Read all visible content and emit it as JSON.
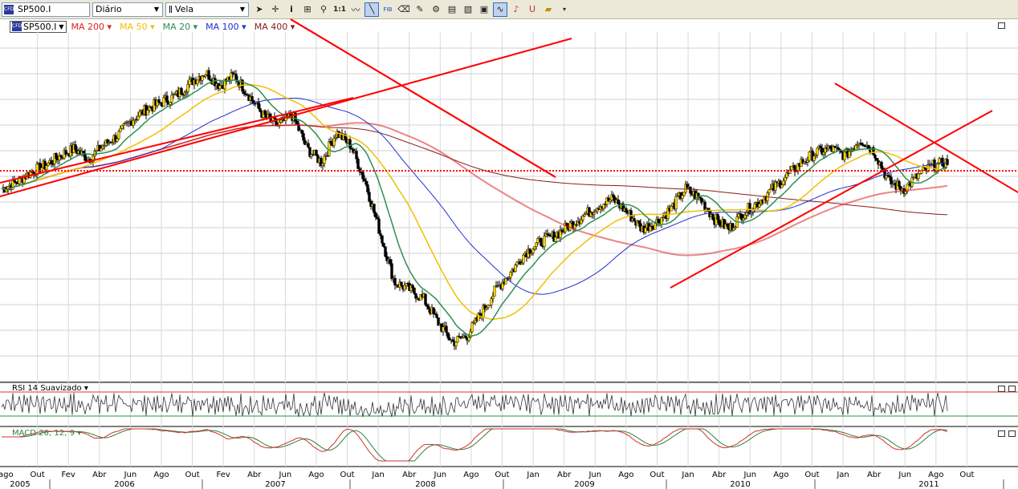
{
  "toolbar": {
    "symbol": "SP500.I",
    "period": "Diário",
    "chart_style": "Vela",
    "tools": [
      "cursor-icon",
      "crosshair-icon",
      "info-icon",
      "grid-icon",
      "zoom-icon",
      "ratio-icon",
      "line-style-icon",
      "trendline-icon",
      "fibonacci-icon",
      "eraser-icon",
      "draw-icon",
      "objects-icon",
      "indicator-icon",
      "compare-icon",
      "template-icon",
      "wave-icon",
      "sound-icon",
      "magnet-icon",
      "folder-icon"
    ],
    "fib_label": "FIB",
    "ratio_label": "1:1"
  },
  "legend": {
    "symbol": "SP500.I",
    "ma": [
      {
        "label": "MA 200",
        "color": "#e02020"
      },
      {
        "label": "MA 50",
        "color": "#f0c000"
      },
      {
        "label": "MA 20",
        "color": "#2f8f4f"
      },
      {
        "label": "MA 100",
        "color": "#2030d0"
      },
      {
        "label": "MA 400",
        "color": "#8b1a1a"
      }
    ]
  },
  "rsi": {
    "label": "RSI 14 Suavizado"
  },
  "macd": {
    "label": "MACD 26; 12; 9"
  },
  "colors": {
    "candle": "#ffd700",
    "grid": "#c8c8c8",
    "trend": "#ff0000"
  },
  "chart_data": {
    "type": "line",
    "title": "",
    "series_name": "SP500.I",
    "x_months": [
      "Out",
      "Fev",
      "Abr",
      "Jun",
      "Ago",
      "Out",
      "Fev",
      "Abr",
      "Jun",
      "Ago",
      "Out",
      "Jan",
      "Abr",
      "Jun",
      "Ago",
      "Out",
      "Jan",
      "Abr",
      "Jun",
      "Ago",
      "Out",
      "Jan",
      "Abr",
      "Jun",
      "Ago",
      "Out",
      "Jan",
      "Abr",
      "Jun",
      "Ago",
      "Out"
    ],
    "x_years": [
      "2005",
      "2006",
      "2007",
      "2008",
      "2009",
      "2010",
      "2011"
    ],
    "first_month_label": "ago",
    "price_path": [
      1180,
      1200,
      1230,
      1250,
      1280,
      1300,
      1270,
      1310,
      1340,
      1390,
      1420,
      1440,
      1460,
      1500,
      1530,
      1490,
      1520,
      1460,
      1400,
      1370,
      1400,
      1300,
      1260,
      1350,
      1310,
      1200,
      1050,
      900,
      880,
      850,
      780,
      720,
      740,
      810,
      880,
      930,
      990,
      1020,
      1040,
      1070,
      1100,
      1130,
      1150,
      1110,
      1060,
      1080,
      1120,
      1180,
      1150,
      1090,
      1060,
      1110,
      1140,
      1180,
      1220,
      1260,
      1290,
      1300,
      1280,
      1330,
      1290,
      1200,
      1180,
      1220,
      1250,
      1260
    ]
  }
}
